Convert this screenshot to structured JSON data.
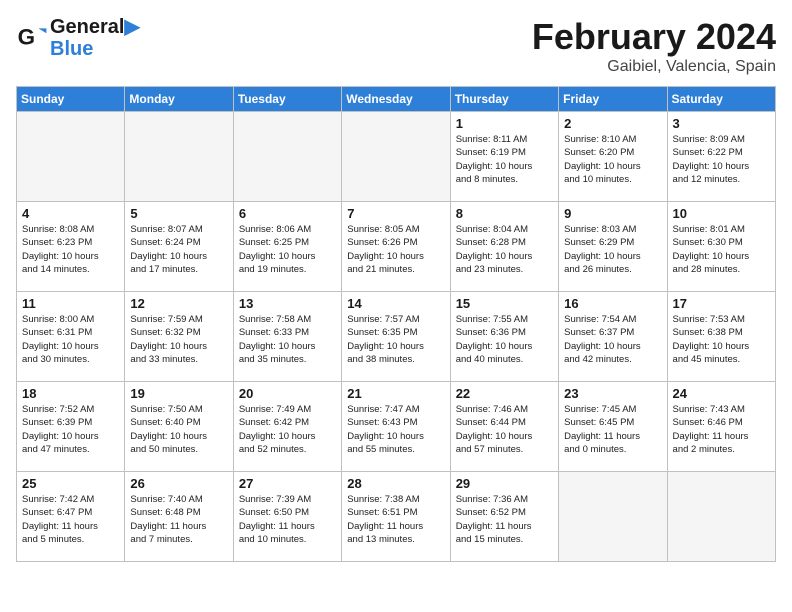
{
  "header": {
    "logo_line1": "General",
    "logo_line2": "Blue",
    "month": "February 2024",
    "location": "Gaibiel, Valencia, Spain"
  },
  "days_of_week": [
    "Sunday",
    "Monday",
    "Tuesday",
    "Wednesday",
    "Thursday",
    "Friday",
    "Saturday"
  ],
  "weeks": [
    [
      {
        "num": "",
        "info": ""
      },
      {
        "num": "",
        "info": ""
      },
      {
        "num": "",
        "info": ""
      },
      {
        "num": "",
        "info": ""
      },
      {
        "num": "1",
        "info": "Sunrise: 8:11 AM\nSunset: 6:19 PM\nDaylight: 10 hours\nand 8 minutes."
      },
      {
        "num": "2",
        "info": "Sunrise: 8:10 AM\nSunset: 6:20 PM\nDaylight: 10 hours\nand 10 minutes."
      },
      {
        "num": "3",
        "info": "Sunrise: 8:09 AM\nSunset: 6:22 PM\nDaylight: 10 hours\nand 12 minutes."
      }
    ],
    [
      {
        "num": "4",
        "info": "Sunrise: 8:08 AM\nSunset: 6:23 PM\nDaylight: 10 hours\nand 14 minutes."
      },
      {
        "num": "5",
        "info": "Sunrise: 8:07 AM\nSunset: 6:24 PM\nDaylight: 10 hours\nand 17 minutes."
      },
      {
        "num": "6",
        "info": "Sunrise: 8:06 AM\nSunset: 6:25 PM\nDaylight: 10 hours\nand 19 minutes."
      },
      {
        "num": "7",
        "info": "Sunrise: 8:05 AM\nSunset: 6:26 PM\nDaylight: 10 hours\nand 21 minutes."
      },
      {
        "num": "8",
        "info": "Sunrise: 8:04 AM\nSunset: 6:28 PM\nDaylight: 10 hours\nand 23 minutes."
      },
      {
        "num": "9",
        "info": "Sunrise: 8:03 AM\nSunset: 6:29 PM\nDaylight: 10 hours\nand 26 minutes."
      },
      {
        "num": "10",
        "info": "Sunrise: 8:01 AM\nSunset: 6:30 PM\nDaylight: 10 hours\nand 28 minutes."
      }
    ],
    [
      {
        "num": "11",
        "info": "Sunrise: 8:00 AM\nSunset: 6:31 PM\nDaylight: 10 hours\nand 30 minutes."
      },
      {
        "num": "12",
        "info": "Sunrise: 7:59 AM\nSunset: 6:32 PM\nDaylight: 10 hours\nand 33 minutes."
      },
      {
        "num": "13",
        "info": "Sunrise: 7:58 AM\nSunset: 6:33 PM\nDaylight: 10 hours\nand 35 minutes."
      },
      {
        "num": "14",
        "info": "Sunrise: 7:57 AM\nSunset: 6:35 PM\nDaylight: 10 hours\nand 38 minutes."
      },
      {
        "num": "15",
        "info": "Sunrise: 7:55 AM\nSunset: 6:36 PM\nDaylight: 10 hours\nand 40 minutes."
      },
      {
        "num": "16",
        "info": "Sunrise: 7:54 AM\nSunset: 6:37 PM\nDaylight: 10 hours\nand 42 minutes."
      },
      {
        "num": "17",
        "info": "Sunrise: 7:53 AM\nSunset: 6:38 PM\nDaylight: 10 hours\nand 45 minutes."
      }
    ],
    [
      {
        "num": "18",
        "info": "Sunrise: 7:52 AM\nSunset: 6:39 PM\nDaylight: 10 hours\nand 47 minutes."
      },
      {
        "num": "19",
        "info": "Sunrise: 7:50 AM\nSunset: 6:40 PM\nDaylight: 10 hours\nand 50 minutes."
      },
      {
        "num": "20",
        "info": "Sunrise: 7:49 AM\nSunset: 6:42 PM\nDaylight: 10 hours\nand 52 minutes."
      },
      {
        "num": "21",
        "info": "Sunrise: 7:47 AM\nSunset: 6:43 PM\nDaylight: 10 hours\nand 55 minutes."
      },
      {
        "num": "22",
        "info": "Sunrise: 7:46 AM\nSunset: 6:44 PM\nDaylight: 10 hours\nand 57 minutes."
      },
      {
        "num": "23",
        "info": "Sunrise: 7:45 AM\nSunset: 6:45 PM\nDaylight: 11 hours\nand 0 minutes."
      },
      {
        "num": "24",
        "info": "Sunrise: 7:43 AM\nSunset: 6:46 PM\nDaylight: 11 hours\nand 2 minutes."
      }
    ],
    [
      {
        "num": "25",
        "info": "Sunrise: 7:42 AM\nSunset: 6:47 PM\nDaylight: 11 hours\nand 5 minutes."
      },
      {
        "num": "26",
        "info": "Sunrise: 7:40 AM\nSunset: 6:48 PM\nDaylight: 11 hours\nand 7 minutes."
      },
      {
        "num": "27",
        "info": "Sunrise: 7:39 AM\nSunset: 6:50 PM\nDaylight: 11 hours\nand 10 minutes."
      },
      {
        "num": "28",
        "info": "Sunrise: 7:38 AM\nSunset: 6:51 PM\nDaylight: 11 hours\nand 13 minutes."
      },
      {
        "num": "29",
        "info": "Sunrise: 7:36 AM\nSunset: 6:52 PM\nDaylight: 11 hours\nand 15 minutes."
      },
      {
        "num": "",
        "info": ""
      },
      {
        "num": "",
        "info": ""
      }
    ]
  ]
}
